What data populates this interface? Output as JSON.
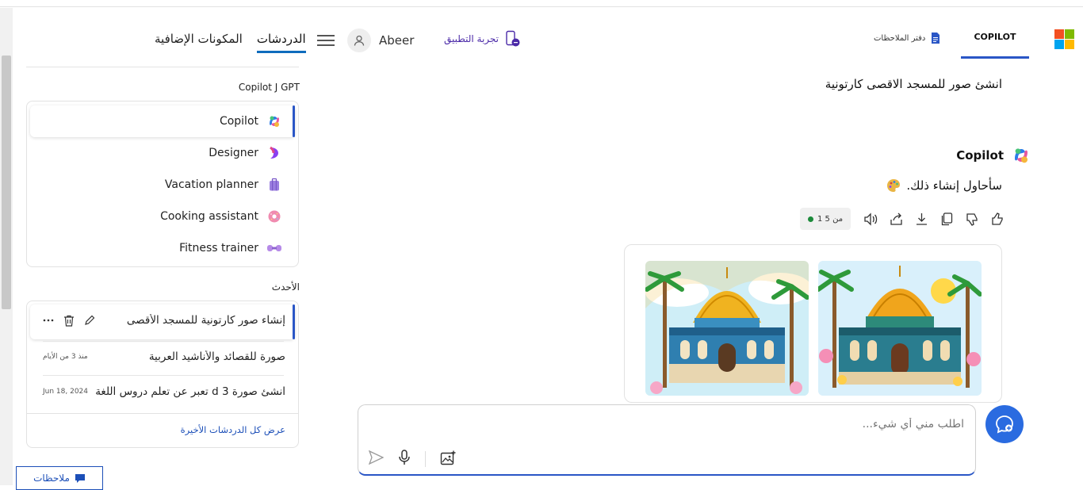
{
  "header": {
    "tabs": [
      {
        "label": "الدردشات",
        "active": true
      },
      {
        "label": "المكونات الإضافية",
        "active": false
      }
    ],
    "user_name": "Abeer",
    "try_app_label": "تجربة التطبيق",
    "copilot_tab": "COPILOT",
    "notebook_tab": "دفتر الملاحظات"
  },
  "gpts": {
    "title": "Copilot J GPT",
    "items": [
      {
        "label": "Copilot",
        "icon": "copilot-icon"
      },
      {
        "label": "Designer",
        "icon": "designer-icon"
      },
      {
        "label": "Vacation planner",
        "icon": "suitcase-icon"
      },
      {
        "label": "Cooking assistant",
        "icon": "donut-icon"
      },
      {
        "label": "Fitness trainer",
        "icon": "dumbbell-icon"
      }
    ]
  },
  "recent": {
    "title": "الأحدث",
    "items": [
      {
        "title": "إنشاء صور كارتونية للمسجد الأقصى",
        "date": ""
      },
      {
        "title": "صورة للقصائد والأناشيد العربية",
        "date": "منذ 3 من الأيام"
      },
      {
        "title": "انشئ صورة 3 d تعبر عن تعلم دروس اللغة",
        "date": "Jun 18, 2024"
      }
    ],
    "see_all": "عرض كل الدردشات الأخيرة"
  },
  "chat": {
    "user_message": "انشئ صور للمسجد الاقصى كارتونية",
    "bot_name": "Copilot",
    "bot_reply": "سأحاول إنشاء ذلك.",
    "page_indicator": "1 من 5"
  },
  "composer": {
    "placeholder": "اطلب مني أي شيء..."
  },
  "feedback_label": "ملاحظات",
  "colors": {
    "accent": "#2a56c6",
    "link": "#1c4fb8",
    "new_topic": "#2a6be0"
  }
}
